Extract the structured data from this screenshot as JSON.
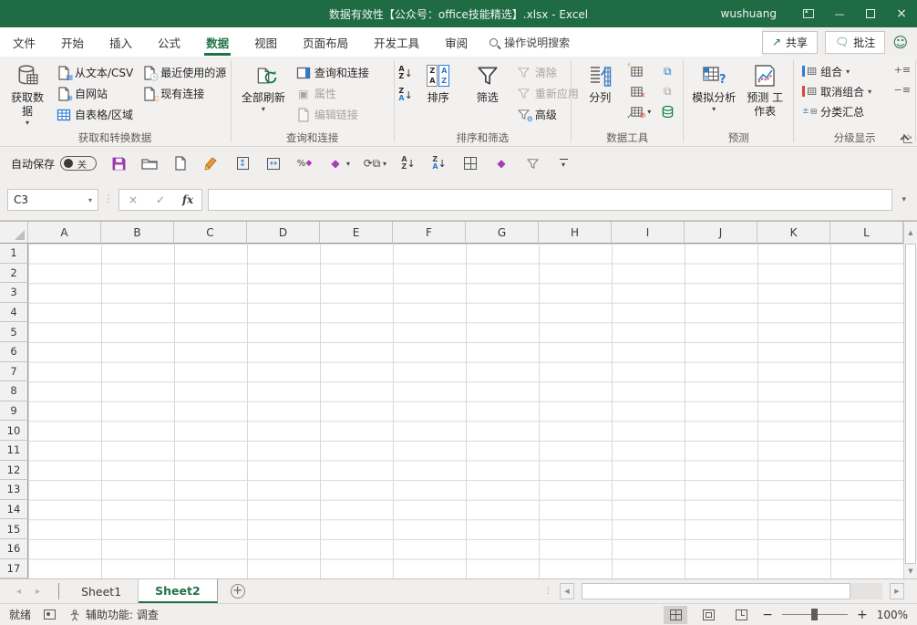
{
  "title_bar": {
    "title": "数据有效性【公众号：office技能精选】.xlsx  -  Excel",
    "user": "wushuang",
    "minimize": "—",
    "close": "✕"
  },
  "tab_row": {
    "tabs": [
      "文件",
      "开始",
      "插入",
      "公式",
      "数据",
      "视图",
      "页面布局",
      "开发工具",
      "审阅"
    ],
    "active_tab": "数据",
    "search_label": "操作说明搜索",
    "share_label": "共享",
    "comments_label": "批注"
  },
  "ribbon": {
    "get_transform": {
      "label": "获取和转换数据",
      "get_data": "获取数据",
      "from_text_csv": "从文本/CSV",
      "from_web": "自网站",
      "from_table_range": "自表格/区域",
      "recent_sources": "最近使用的源",
      "existing_connections": "现有连接"
    },
    "queries_connections": {
      "label": "查询和连接",
      "refresh_all": "全部刷新",
      "queries": "查询和连接",
      "properties": "属性",
      "edit_links": "编辑链接"
    },
    "sort_filter": {
      "label": "排序和筛选",
      "sort": "排序",
      "filter": "筛选",
      "clear": "清除",
      "reapply": "重新应用",
      "advanced": "高级"
    },
    "data_tools": {
      "label": "数据工具",
      "text_to_columns": "分列"
    },
    "forecast": {
      "label": "预测",
      "what_if": "模拟分析",
      "forecast_sheet": "预测 工作表"
    },
    "outline": {
      "label": "分级显示",
      "group": "组合",
      "ungroup": "取消组合",
      "subtotal": "分类汇总"
    }
  },
  "qat": {
    "autosave_label": "自动保存",
    "autosave_state": "关"
  },
  "formula_bar": {
    "name_box": "C3",
    "cancel": "×",
    "enter": "✓",
    "fx_label": "fx"
  },
  "grid": {
    "columns": [
      "A",
      "B",
      "C",
      "D",
      "E",
      "F",
      "G",
      "H",
      "I",
      "J",
      "K",
      "L"
    ],
    "rows": [
      "1",
      "2",
      "3",
      "4",
      "5",
      "6",
      "7",
      "8",
      "9",
      "10",
      "11",
      "12",
      "13",
      "14",
      "15",
      "16",
      "17"
    ]
  },
  "sheet_tabs": {
    "sheet1": "Sheet1",
    "sheet2": "Sheet2",
    "active": "Sheet2"
  },
  "status_bar": {
    "ready": "就绪",
    "accessibility": "辅助功能: 调查",
    "zoom_level": "100%"
  },
  "colors": {
    "accent_green": "#217346",
    "titlebar_green": "#1f6b44",
    "save_purple": "#a63fb5",
    "brush_orange": "#e8973d"
  }
}
